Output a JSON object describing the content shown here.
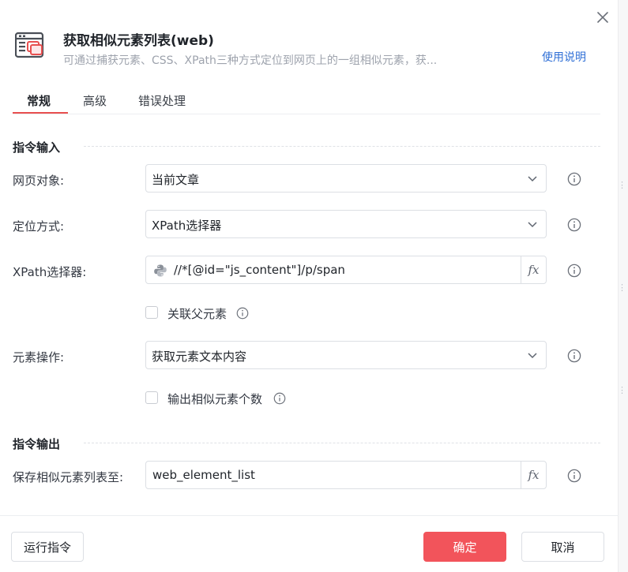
{
  "header": {
    "title": "获取相似元素列表(web)",
    "description": "可通过捕获元素、CSS、XPath三种方式定位到网页上的一组相似元素，获...",
    "help_link": "使用说明"
  },
  "tabs": [
    {
      "label": "常规",
      "active": true
    },
    {
      "label": "高级",
      "active": false
    },
    {
      "label": "错误处理",
      "active": false
    }
  ],
  "input_section": {
    "title": "指令输入",
    "web_object": {
      "label": "网页对象:",
      "value": "当前文章"
    },
    "locate_method": {
      "label": "定位方式:",
      "value": "XPath选择器"
    },
    "xpath": {
      "label": "XPath选择器:",
      "value": "//*[@id=\"js_content\"]/p/span",
      "fx": "fx"
    },
    "link_parent": {
      "label": "关联父元素",
      "checked": false
    },
    "element_op": {
      "label": "元素操作:",
      "value": "获取元素文本内容"
    },
    "output_count": {
      "label": "输出相似元素个数",
      "checked": false
    }
  },
  "output_section": {
    "title": "指令输出",
    "save_to": {
      "label": "保存相似元素列表至:",
      "value": "web_element_list",
      "fx": "fx"
    }
  },
  "footer": {
    "run_label": "运行指令",
    "ok_label": "确定",
    "cancel_label": "取消"
  },
  "colors": {
    "accent": "#e84f4f",
    "primary_button": "#f2545b",
    "link": "#2f6fd6"
  }
}
